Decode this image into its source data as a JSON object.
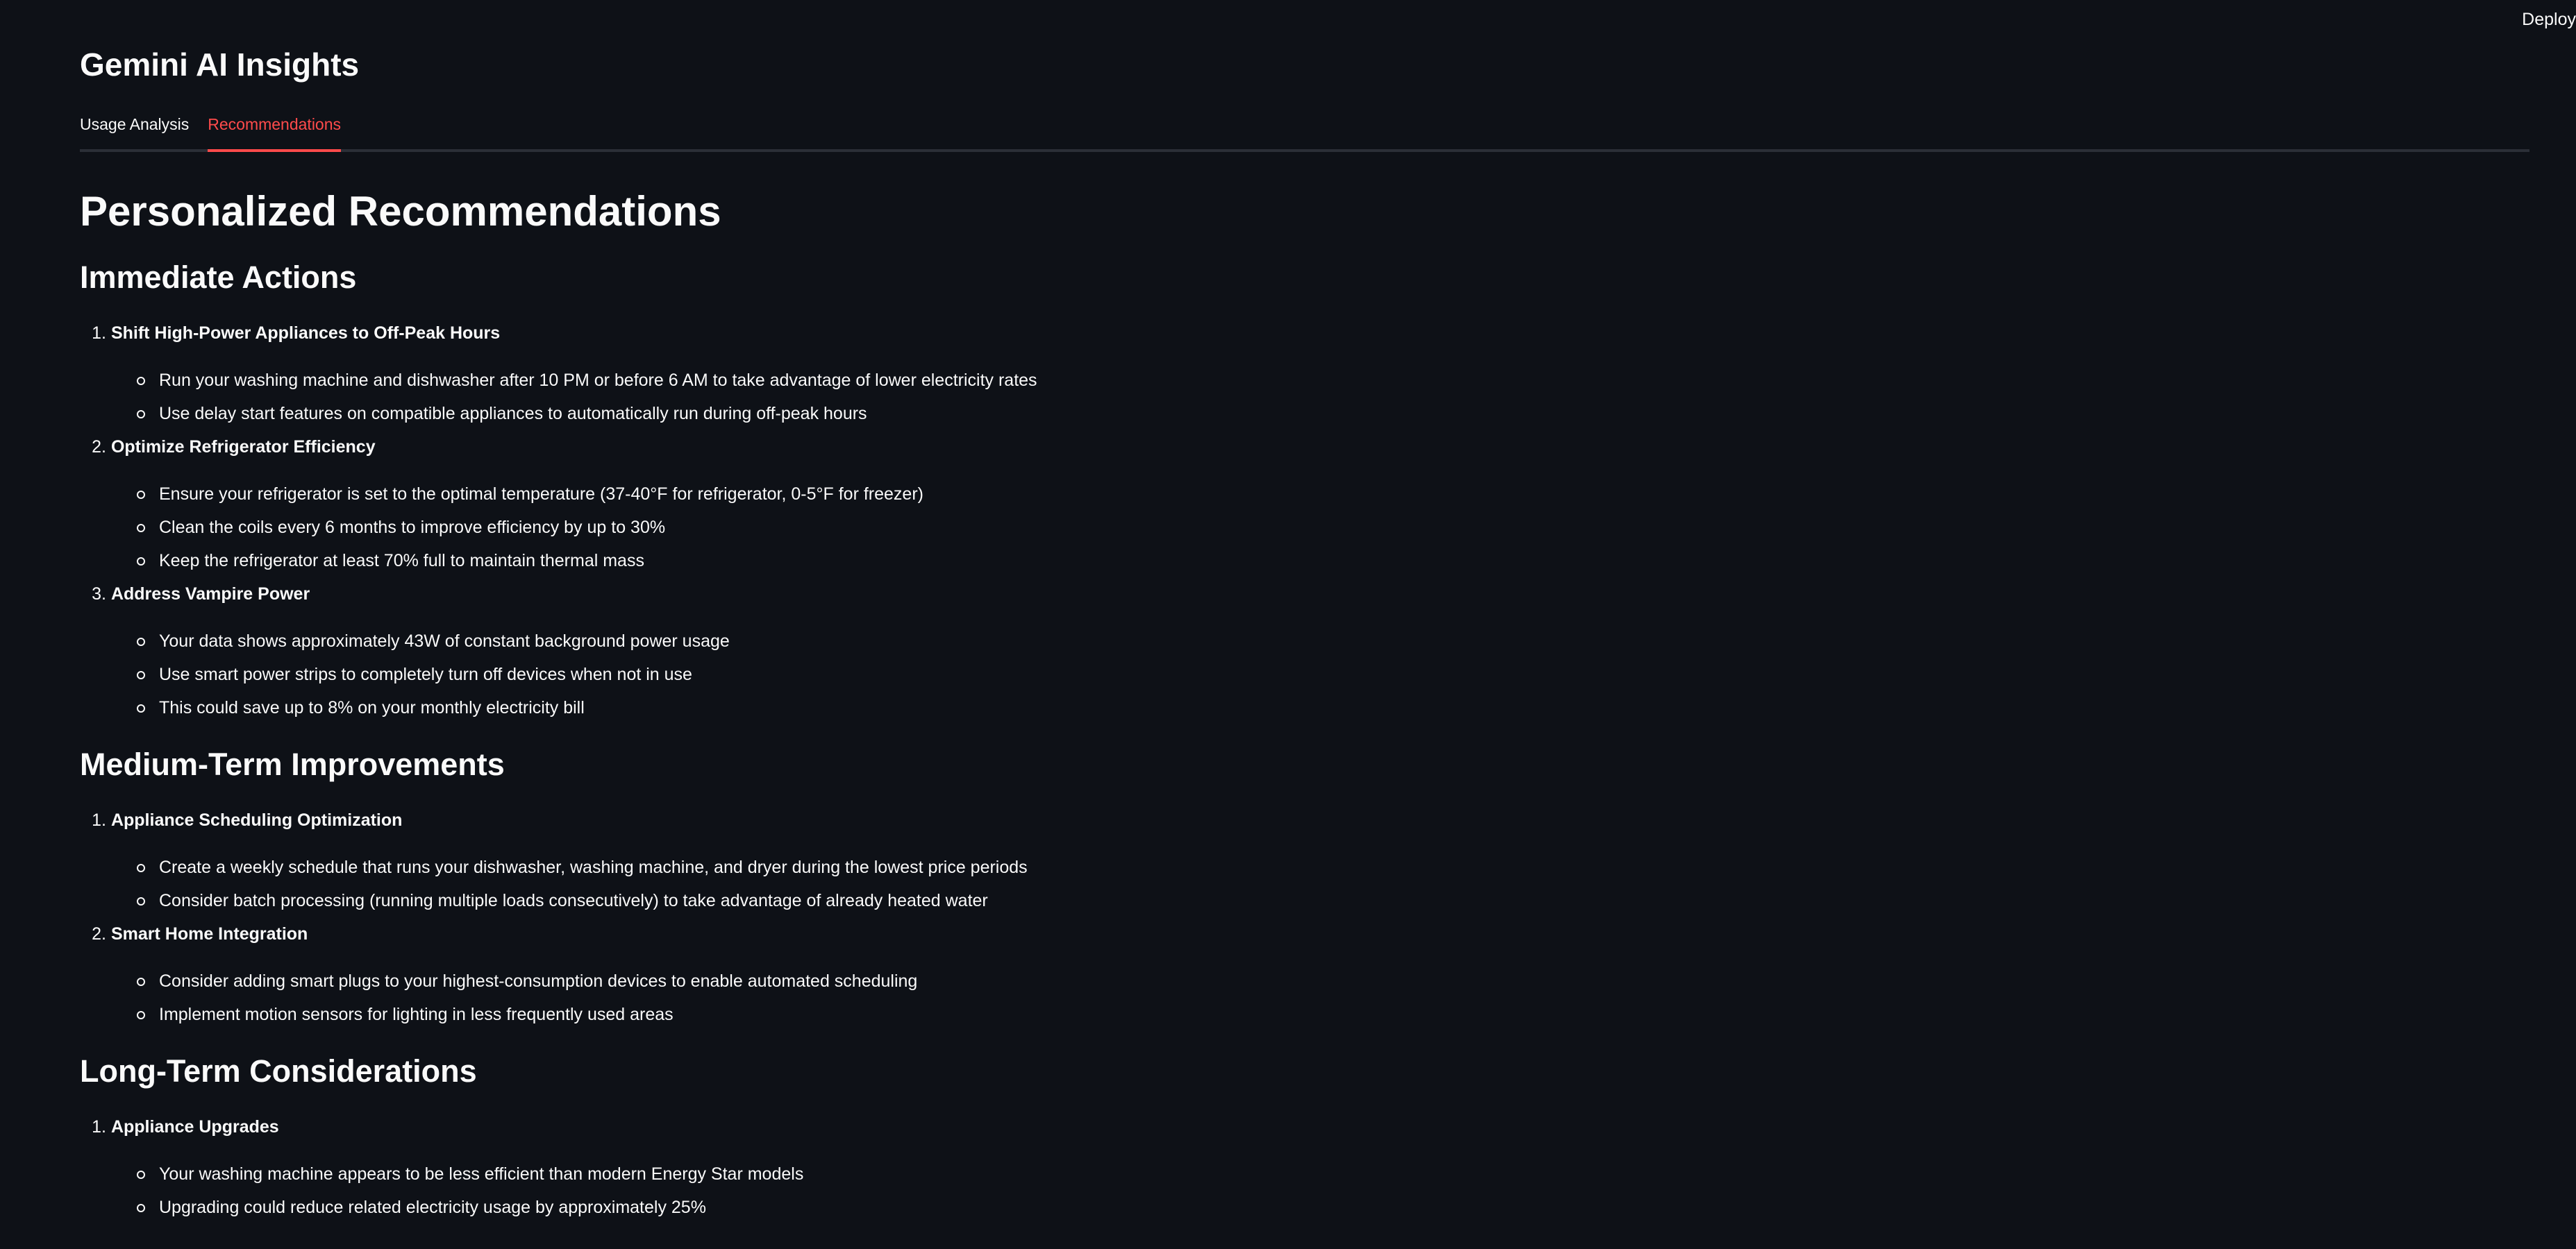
{
  "header": {
    "deploy_label": "Deploy"
  },
  "app": {
    "title": "Gemini AI Insights"
  },
  "tabs": [
    {
      "label": "Usage Analysis",
      "active": false
    },
    {
      "label": "Recommendations",
      "active": true
    }
  ],
  "page": {
    "heading": "Personalized Recommendations",
    "sections": [
      {
        "title": "Immediate Actions",
        "items": [
          {
            "num": "1.",
            "title": "Shift High-Power Appliances to Off-Peak Hours",
            "bullets": [
              "Run your washing machine and dishwasher after 10 PM or before 6 AM to take advantage of lower electricity rates",
              "Use delay start features on compatible appliances to automatically run during off-peak hours"
            ]
          },
          {
            "num": "2.",
            "title": "Optimize Refrigerator Efficiency",
            "bullets": [
              "Ensure your refrigerator is set to the optimal temperature (37-40°F for refrigerator, 0-5°F for freezer)",
              "Clean the coils every 6 months to improve efficiency by up to 30%",
              "Keep the refrigerator at least 70% full to maintain thermal mass"
            ]
          },
          {
            "num": "3.",
            "title": "Address Vampire Power",
            "bullets": [
              "Your data shows approximately 43W of constant background power usage",
              "Use smart power strips to completely turn off devices when not in use",
              "This could save up to 8% on your monthly electricity bill"
            ]
          }
        ]
      },
      {
        "title": "Medium-Term Improvements",
        "items": [
          {
            "num": "1.",
            "title": "Appliance Scheduling Optimization",
            "bullets": [
              "Create a weekly schedule that runs your dishwasher, washing machine, and dryer during the lowest price periods",
              "Consider batch processing (running multiple loads consecutively) to take advantage of already heated water"
            ]
          },
          {
            "num": "2.",
            "title": "Smart Home Integration",
            "bullets": [
              "Consider adding smart plugs to your highest-consumption devices to enable automated scheduling",
              "Implement motion sensors for lighting in less frequently used areas"
            ]
          }
        ]
      },
      {
        "title": "Long-Term Considerations",
        "items": [
          {
            "num": "1.",
            "title": "Appliance Upgrades",
            "bullets": [
              "Your washing machine appears to be less efficient than modern Energy Star models",
              "Upgrading could reduce related electricity usage by approximately 25%"
            ]
          }
        ]
      }
    ]
  }
}
